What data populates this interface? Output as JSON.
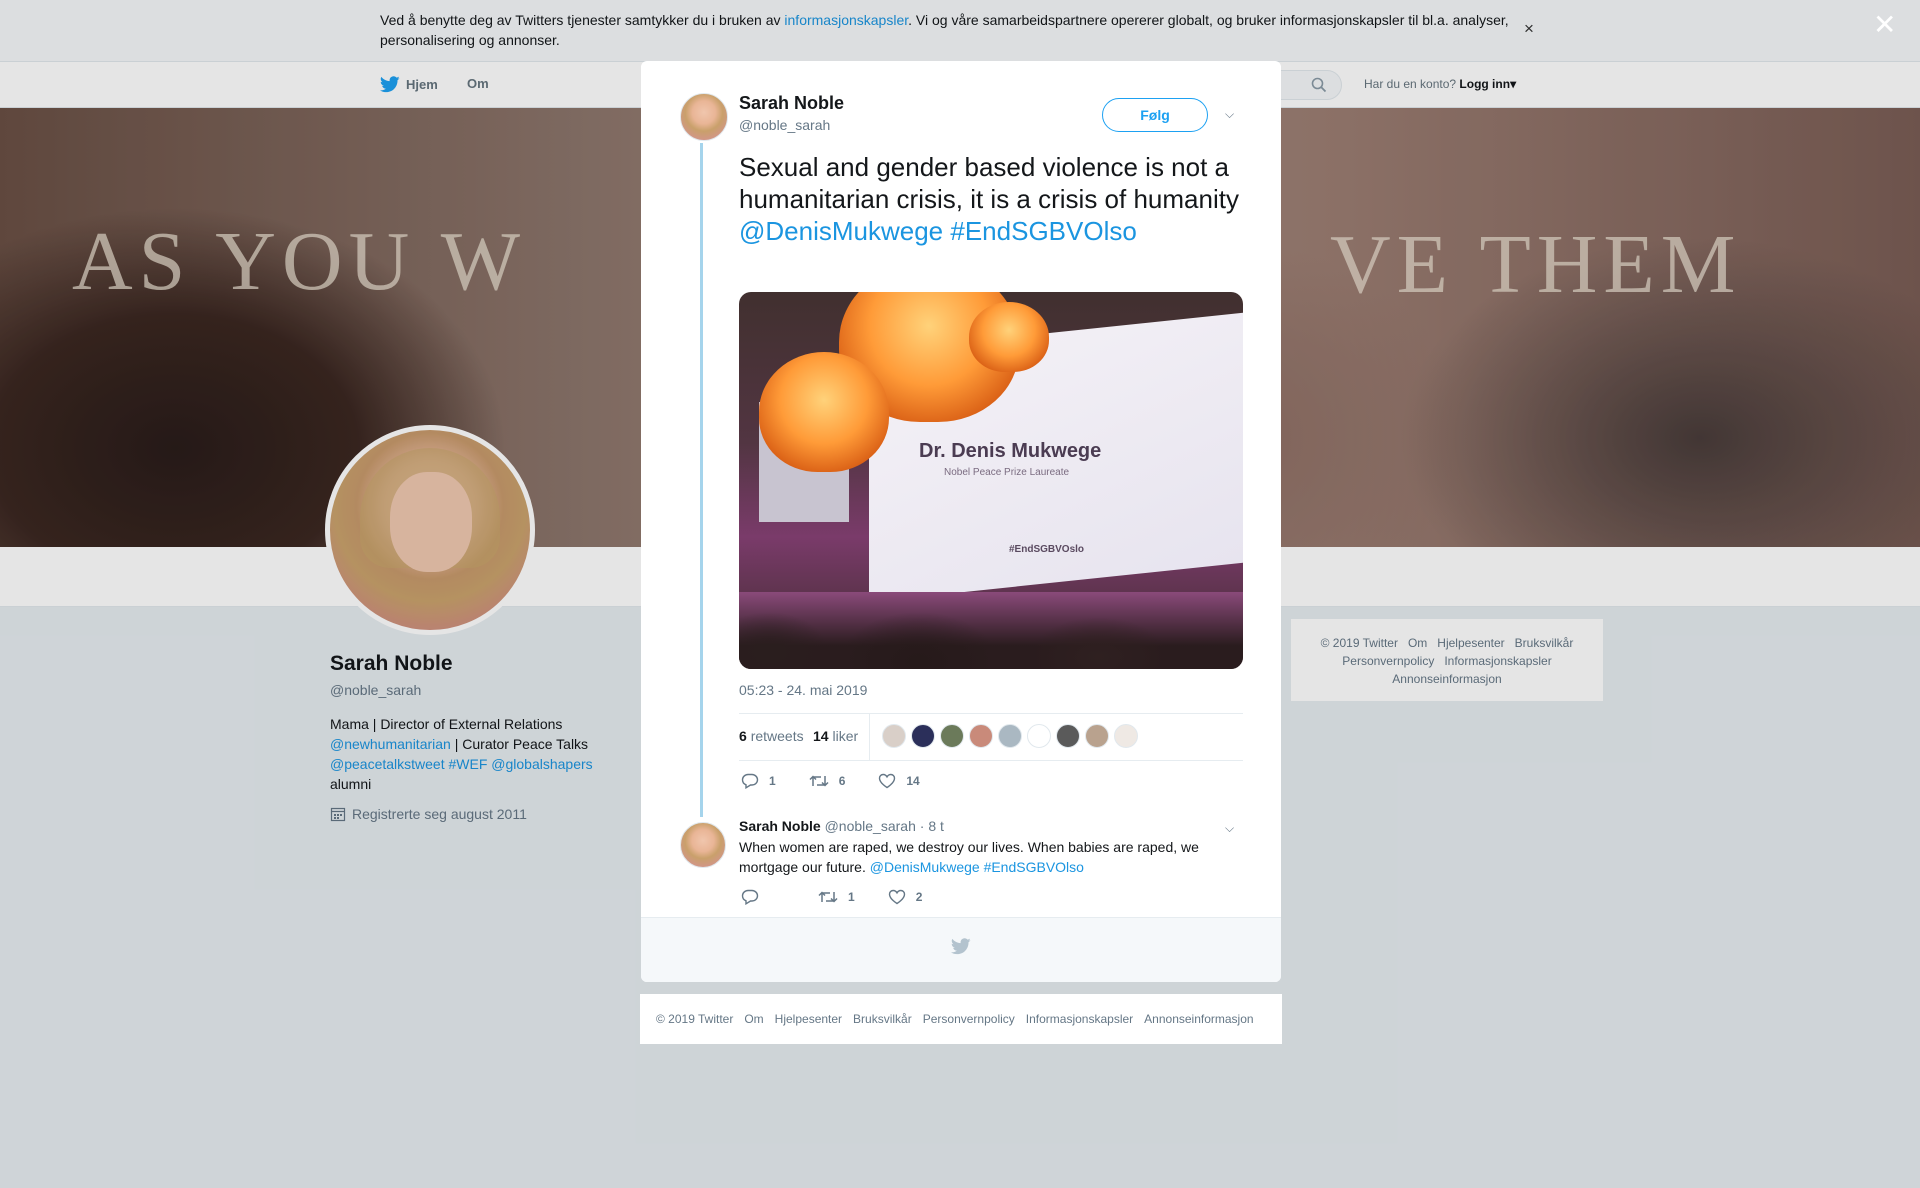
{
  "cookie_banner": {
    "text_before": "Ved å benytte deg av Twitters tjenester samtykker du i bruken av ",
    "link": "informasjonskapsler",
    "text_after": ". Vi og våre samarbeidspartnere opererer globalt, og bruker informasjonskapsler til bl.a. analyser, personalisering og annonser.",
    "close": "×"
  },
  "nav": {
    "home": "Hjem",
    "about": "Om",
    "account_prompt": "Har du en konto?",
    "login": "Logg inn",
    "login_caret": "▾"
  },
  "banner": {
    "word_left": "AS YOU W",
    "word_right": "VE THEM"
  },
  "profile": {
    "name": "Sarah Noble",
    "handle": "@noble_sarah",
    "bio_line1": "Mama | Director of External Relations",
    "bio_link1": "@newhumanitarian",
    "bio_mid": " | Curator Peace Talks",
    "bio_link2": "@peacetalkstweet",
    "bio_link3": "#WEF",
    "bio_link4": "@globalshapers",
    "bio_end": "alumni",
    "joined": "Registrerte seg august 2011"
  },
  "side_footer": {
    "items": [
      "© 2019 Twitter",
      "Om",
      "Hjelpesenter",
      "Bruksvilkår",
      "Personvernpolicy",
      "Informasjonskapsler",
      "Annonseinformasjon"
    ]
  },
  "overlay": {
    "close": "✕"
  },
  "tweet": {
    "author_name": "Sarah Noble",
    "author_handle": "@noble_sarah",
    "follow_label": "Følg",
    "chevron": "⌵",
    "text": "Sexual and gender based violence is not a humanitarian crisis, it is a crisis of humanity ",
    "mention": "@DenisMukwege",
    "hashtag": "#EndSGBVOlso",
    "media": {
      "screen_name": "Dr. Denis Mukwege",
      "screen_subtitle": "Nobel Peace Prize Laureate",
      "screen_tag": "#EndSGBVOslo"
    },
    "timestamp": "05:23 - 24. mai 2019",
    "retweets_count": "6",
    "retweets_label": "retweets",
    "likes_count": "14",
    "likes_label": "liker",
    "likers": [
      "#d9cfc8",
      "#2b2f5a",
      "#6b7a5a",
      "#c98a7a",
      "#aab8c2",
      "#ffffff",
      "#5a5a5a",
      "#b9a28e",
      "#efe9e4"
    ],
    "actions": {
      "reply_count": "1",
      "retweet_count": "6",
      "like_count": "14"
    }
  },
  "reply": {
    "author_name": "Sarah Noble",
    "author_handle": "@noble_sarah",
    "time": "· 8 t",
    "chevron": "⌵",
    "text": "When women are raped, we destroy our lives. When babies are raped, we mortgage our future. ",
    "mention": "@DenisMukwege",
    "hashtag": "#EndSGBVOlso",
    "actions": {
      "reply_count": "",
      "retweet_count": "1",
      "like_count": "2"
    }
  },
  "modal_footer": {
    "items": [
      "© 2019 Twitter",
      "Om",
      "Hjelpesenter",
      "Bruksvilkår",
      "Personvernpolicy",
      "Informasjonskapsler",
      "Annonseinformasjon"
    ]
  },
  "colors": {
    "accent": "#1da1f2",
    "link": "#1b95e0",
    "thread_line": "#a5d4ec"
  }
}
